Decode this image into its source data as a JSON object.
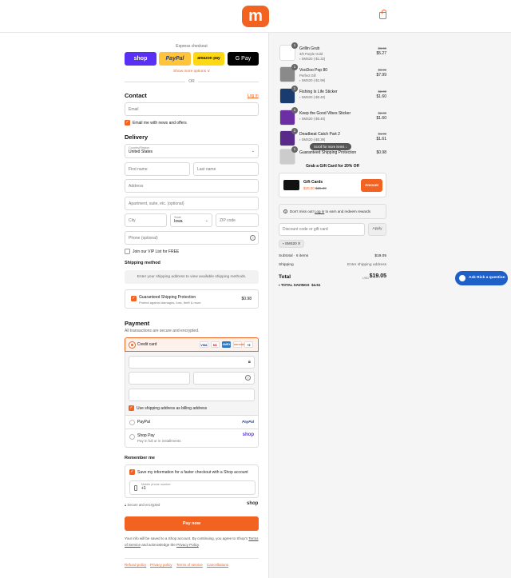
{
  "header": {
    "logo_letter": "m",
    "cart_icon": "shopping-bag-icon",
    "brand_color": "#f26322"
  },
  "express": {
    "title": "Express checkout",
    "shop_label": "shop",
    "paypal_label": "PayPal",
    "amazon_label": "amazon pay",
    "gpay_label": "G Pay",
    "show_more": "Show more options ∨",
    "or": "OR"
  },
  "contact": {
    "heading": "Contact",
    "login": "Log in",
    "email_placeholder": "Email",
    "news_label": "Email me with news and offers"
  },
  "delivery": {
    "heading": "Delivery",
    "country_label": "Country/Region",
    "country_value": "United States",
    "first_name": "First name",
    "last_name": "Last name",
    "address": "Address",
    "apartment": "Apartment, suite, etc. (optional)",
    "city": "City",
    "state_label": "State",
    "state_value": "Iowa",
    "zip": "ZIP code",
    "phone": "Phone (optional)",
    "vip_label": "Join our VIP List for FREE"
  },
  "shipping": {
    "heading": "Shipping method",
    "note": "Enter your shipping address to view available shipping methods.",
    "protection_title": "Guaranteed Shipping Protection",
    "protection_sub": "Protect against damages, loss, theft & more",
    "protection_price": "$0.98"
  },
  "payment": {
    "heading": "Payment",
    "sub": "All transactions are secure and encrypted.",
    "credit_card": "Credit card",
    "card_brands": [
      "VISA",
      "MC",
      "AMEX",
      "DISCOVER",
      "+5"
    ],
    "billing_label": "Use shipping address as billing address",
    "paypal": "PayPal",
    "paypal_logo": "PayPal",
    "shoppay": "Shop Pay",
    "shoppay_sub": "Pay in full or in installments",
    "shoppay_logo": "shop"
  },
  "remember": {
    "heading": "Remember me",
    "save_label": "Save my information for a faster checkout with a Shop account",
    "phone_label": "Mobile phone number",
    "phone_value": "+1",
    "secure": "Secure and encrypted",
    "shop_logo": "shop"
  },
  "pay_button": "Pay now",
  "legal": {
    "line1": "Your info will be saved to a Shop account. By continuing, you agree to Shop’s",
    "tos": "Terms of Service",
    "and": " and acknowledge the ",
    "privacy": "Privacy Policy",
    "end": "."
  },
  "footer_links": [
    "Refund policy",
    "Privacy policy",
    "Terms of service",
    "Cancellations"
  ],
  "cart": {
    "items": [
      {
        "qty": "1",
        "title": "Grillin Grub",
        "variant": "3/0 Purple Gold",
        "discount": "SMS20 (-$1.32)",
        "old": "$6.59",
        "price": "$5.27",
        "color": "#ffffff"
      },
      {
        "qty": "1",
        "title": "VooDoo Pop 80",
        "variant": "Perfect Gill",
        "discount": "SMS20 (-$1.99)",
        "old": "$9.99",
        "price": "$7.99",
        "color": "#8a8a8a"
      },
      {
        "qty": "1",
        "title": "Fishing Is Life Sticker",
        "variant": "",
        "discount": "SMS20 (-$0.40)",
        "old": "$2.00",
        "price": "$1.60",
        "color": "#1a3b6e"
      },
      {
        "qty": "1",
        "title": "Keep the Good Vibes Sticker",
        "variant": "",
        "discount": "SMS20 (-$0.40)",
        "old": "$2.00",
        "price": "$1.60",
        "color": "#6b2fa3"
      },
      {
        "qty": "1",
        "title": "Deadbeat Catch Part 2",
        "variant": "",
        "discount": "SMS20 (-$0.39)",
        "old": "$1.99",
        "price": "$1.61",
        "color": "#5a2a8a"
      },
      {
        "qty": "1",
        "title": "Guaranteed Shipping Protection",
        "variant": "",
        "discount": "",
        "old": "",
        "price": "$0.98",
        "color": "#cccccc"
      }
    ],
    "scroll_hint": "Scroll for more items ↓",
    "gift_heading": "Grab a Gift Card for 20% Off",
    "gift_title": "Gift Cards",
    "gift_new": "$20.00",
    "gift_old": "$25.00",
    "gift_amount": "Amount",
    "rewards_text_a": "Don’t miss out! ",
    "rewards_link": "Log in",
    "rewards_text_b": " to earn and redeem rewards",
    "discount_placeholder": "Discount code or gift card",
    "apply": "Apply",
    "code_tag": "SMS20",
    "subtotal_label": "Subtotal · 6 items",
    "subtotal": "$19.05",
    "shipping_label": "Shipping",
    "shipping_value": "Enter shipping address",
    "total_label": "Total",
    "currency": "USD",
    "total": "$19.05",
    "savings_label": "TOTAL SAVINGS",
    "savings": "$4.51"
  },
  "chat": {
    "label": "Ask Rick a question"
  }
}
